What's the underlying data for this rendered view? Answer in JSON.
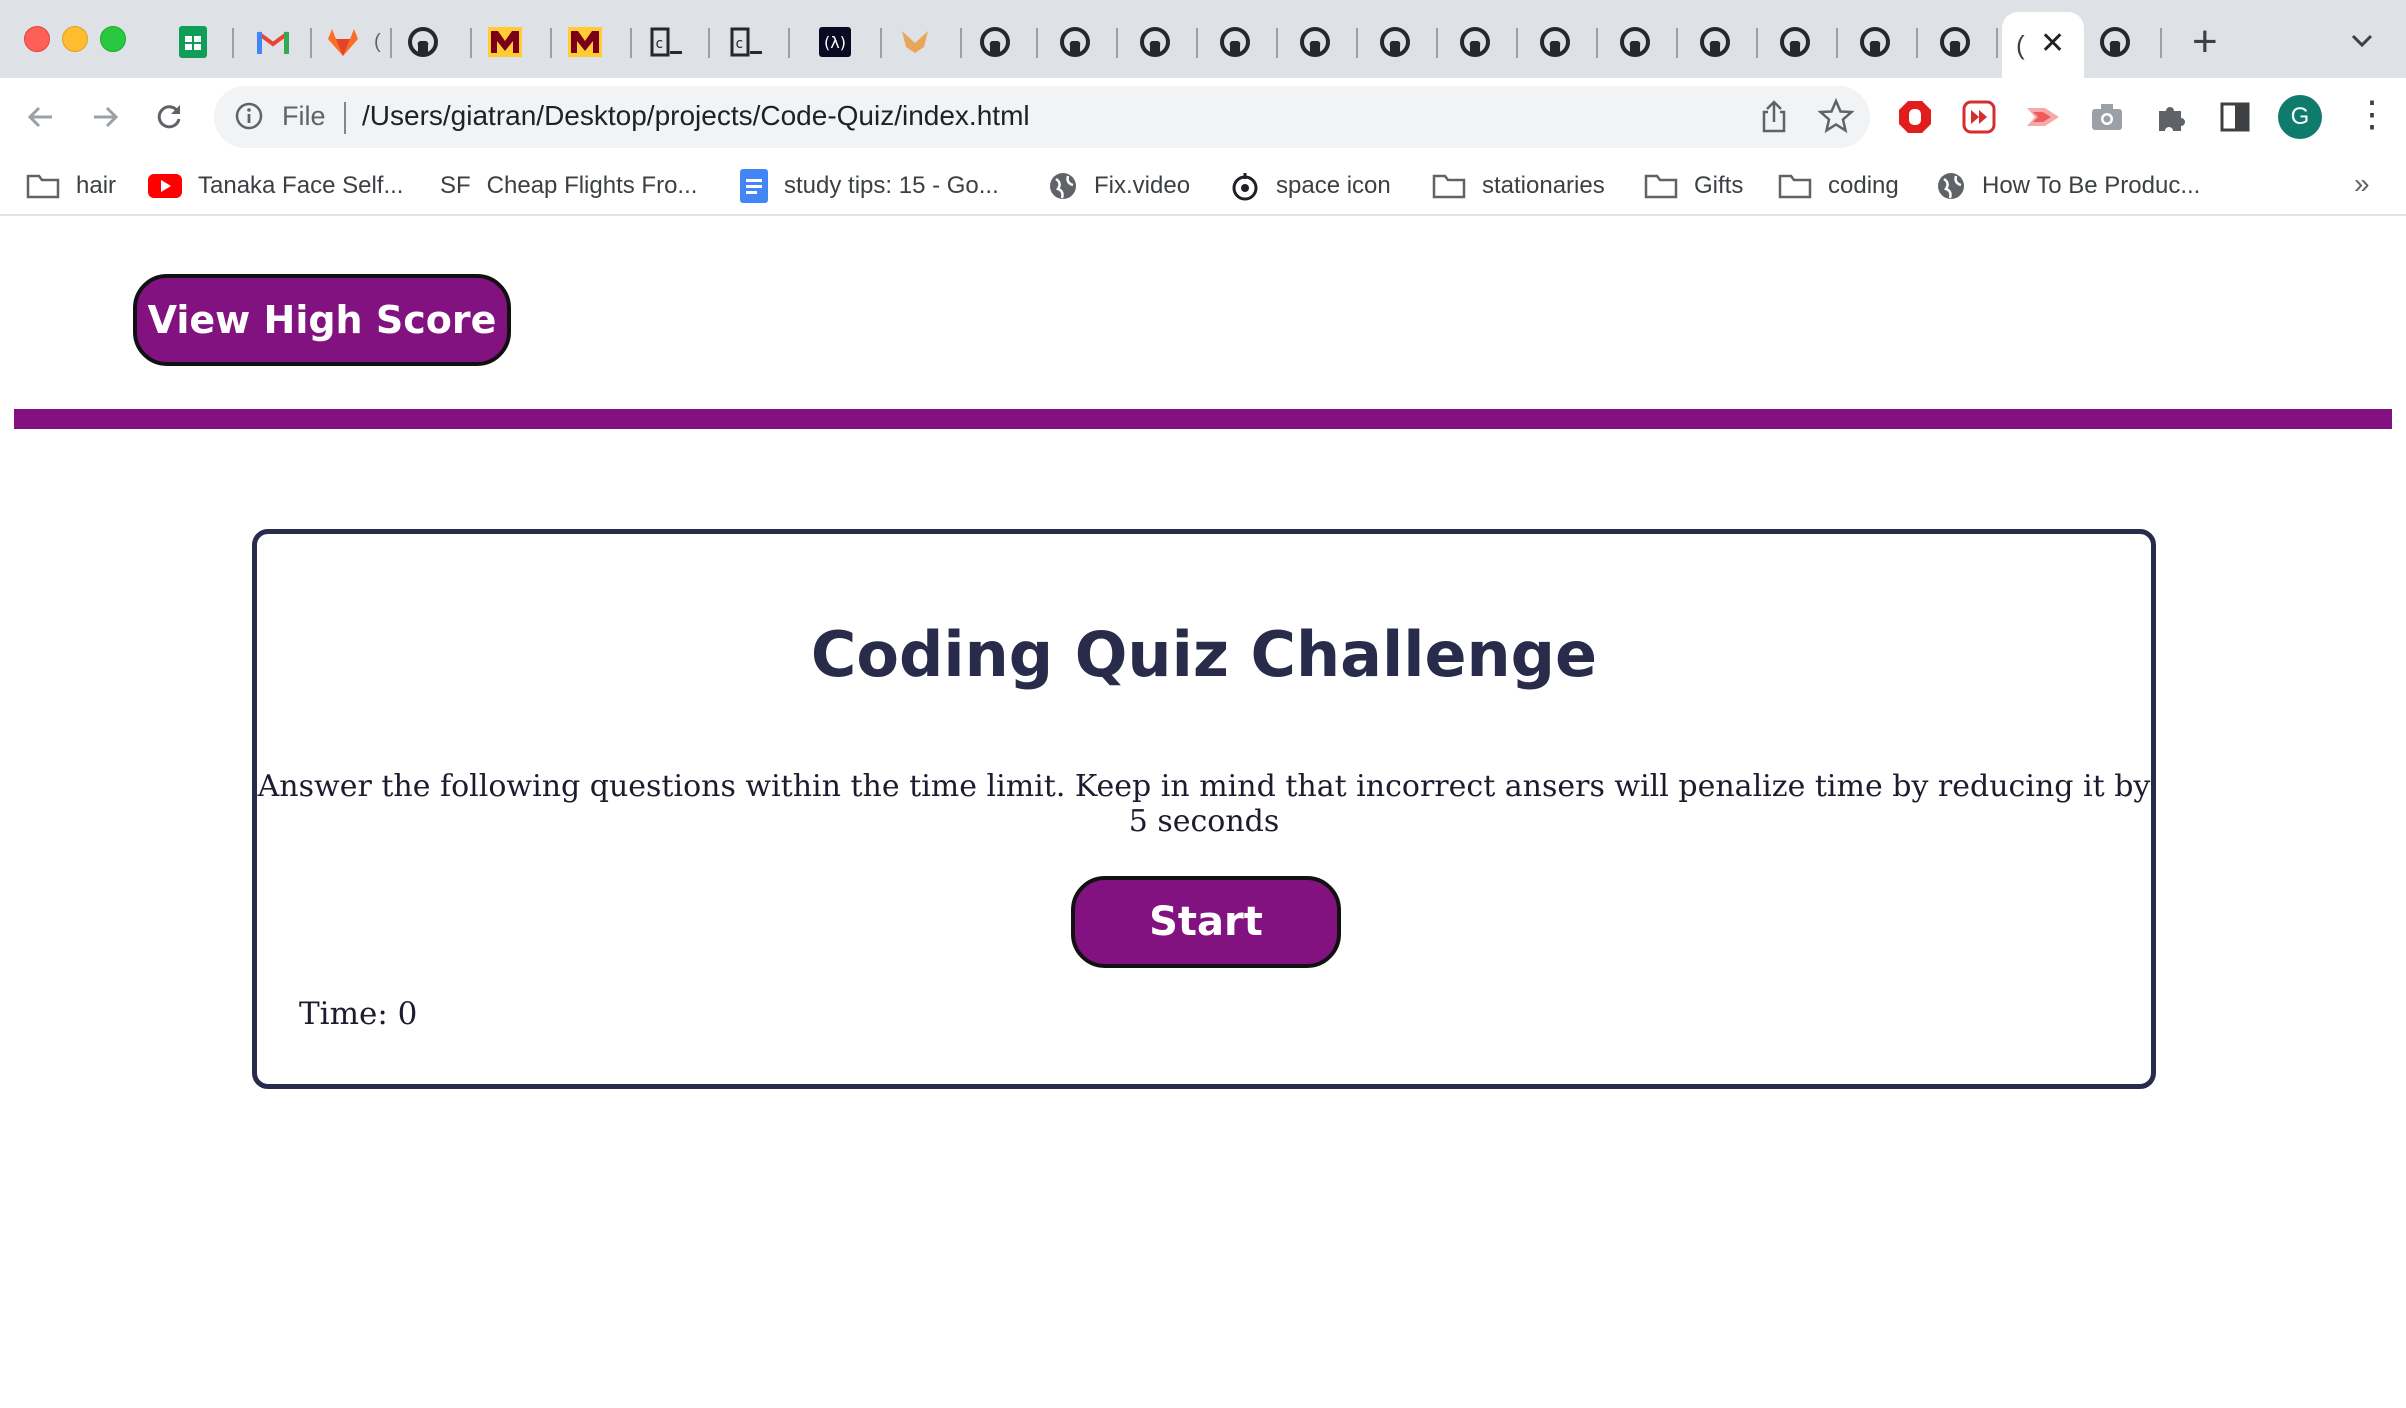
{
  "browser": {
    "tabs": [
      {
        "icon": "google-sheets-icon"
      },
      {
        "icon": "gmail-icon"
      },
      {
        "icon": "gitlab-icon"
      },
      {
        "icon": "github-icon"
      },
      {
        "icon": "university-m-icon"
      },
      {
        "icon": "university-m-icon"
      },
      {
        "icon": "code-terminal-icon"
      },
      {
        "icon": "code-terminal-icon"
      },
      {
        "icon": "freecodecamp-icon"
      },
      {
        "icon": "fox-icon"
      },
      {
        "icon": "github-icon"
      },
      {
        "icon": "github-icon"
      },
      {
        "icon": "github-icon"
      },
      {
        "icon": "github-icon"
      },
      {
        "icon": "github-icon"
      },
      {
        "icon": "github-icon"
      },
      {
        "icon": "github-icon"
      },
      {
        "icon": "github-icon"
      },
      {
        "icon": "github-icon"
      },
      {
        "icon": "github-icon"
      },
      {
        "icon": "github-icon"
      },
      {
        "icon": "github-icon"
      },
      {
        "icon": "github-icon"
      }
    ],
    "active_tab": {
      "title_fragment": "(",
      "close": "✕"
    },
    "new_tab": "+",
    "omnibox": {
      "scheme_label": "File",
      "url": "/Users/giatran/Desktop/projects/Code-Quiz/index.html"
    },
    "profile_initial": "G",
    "bookmarks": [
      {
        "label": "hair",
        "icon": "folder-icon"
      },
      {
        "label": "Tanaka Face Self...",
        "icon": "youtube-icon"
      },
      {
        "label": "Cheap Flights Fro...",
        "icon": "skyscanner-icon",
        "icon_text": "SF"
      },
      {
        "label": "study tips: 15 - Go...",
        "icon": "google-docs-icon"
      },
      {
        "label": "Fix.video",
        "icon": "globe-icon"
      },
      {
        "label": "space icon",
        "icon": "space-icon"
      },
      {
        "label": "stationaries",
        "icon": "folder-icon"
      },
      {
        "label": "Gifts",
        "icon": "folder-icon"
      },
      {
        "label": "coding",
        "icon": "folder-icon"
      },
      {
        "label": "How To Be Produc...",
        "icon": "globe-icon"
      }
    ],
    "bookmarks_overflow": "»",
    "colors": {
      "tabstrip": "#dee1e6",
      "omnibox": "#f1f3f4",
      "avatar": "#0f7b6c"
    }
  },
  "page": {
    "high_score_button": "View High Score",
    "quiz": {
      "title": "Coding Quiz Challenge",
      "description": "Answer the following questions within the time limit. Keep in mind that incorrect ansers will penalize time by reducing it by 5 seconds",
      "start_button": "Start",
      "timer_label": "Time:",
      "timer_value": "0"
    },
    "colors": {
      "accent": "#82127f",
      "text": "#282b4a",
      "border": "#282b4a"
    }
  }
}
